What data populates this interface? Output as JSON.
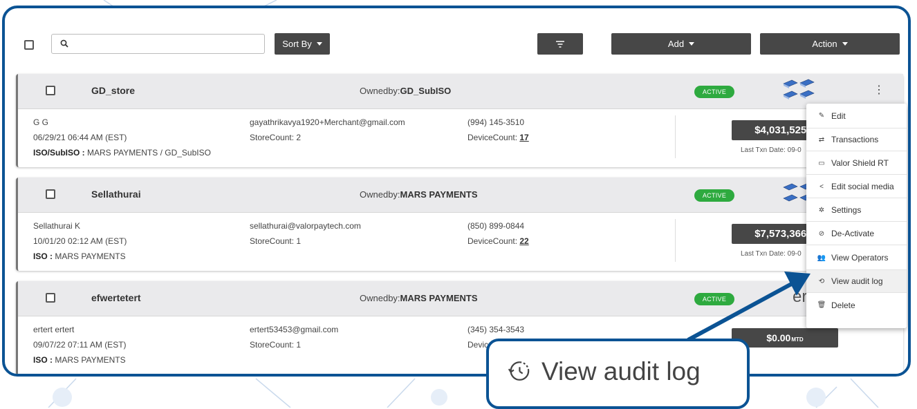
{
  "toolbar": {
    "search_placeholder": "",
    "sort_label": "Sort By",
    "add_label": "Add",
    "action_label": "Action"
  },
  "merchants": [
    {
      "name": "GD_store",
      "owned_prefix": "Ownedby:",
      "owned_by": "GD_SubISO",
      "status": "ACTIVE",
      "contact": "G G",
      "created": "06/29/21 06:44 AM (EST)",
      "iso_label": "ISO/SubISO :",
      "iso_value": " MARS PAYMENTS / GD_SubISO",
      "email": "gayathrikavya1920+Merchant@gmail.com",
      "store_count": "StoreCount: 2",
      "phone": "(994) 145-3510",
      "device_prefix": "DeviceCount: ",
      "device_count": "17",
      "amount": "$4,031,525.9",
      "txn_date": "Last Txn Date: 09-0"
    },
    {
      "name": "Sellathurai",
      "owned_prefix": "Ownedby:",
      "owned_by": "MARS PAYMENTS",
      "status": "ACTIVE",
      "contact": "Sellathurai K",
      "created": "10/01/20 02:12 AM (EST)",
      "iso_label": "ISO :",
      "iso_value": " MARS PAYMENTS",
      "email": "sellathurai@valorpaytech.com",
      "store_count": "StoreCount: 1",
      "phone": "(850) 899-0844",
      "device_prefix": "DeviceCount: ",
      "device_count": "22",
      "amount": "$7,573,366.7",
      "txn_date": "Last Txn Date: 09-0"
    },
    {
      "name": "efwertetert",
      "owned_prefix": "Ownedby:",
      "owned_by": "MARS PAYMENTS",
      "status": "ACTIVE",
      "contact": "ertert ertert",
      "created": "09/07/22 07:11 AM (EST)",
      "iso_label": "ISO :",
      "iso_value": " MARS PAYMENTS",
      "email": "ertert53453@gmail.com",
      "store_count": "StoreCount: 1",
      "phone": "(345) 354-3543",
      "device_prefix": "Device",
      "amount": "$0.00",
      "amount_suffix": "MTD",
      "logo_partial": "er"
    }
  ],
  "menu": {
    "items": [
      {
        "label": "Edit",
        "icon": "pencil-icon"
      },
      {
        "label": "Transactions",
        "icon": "transactions-icon"
      },
      {
        "label": "Valor Shield RT",
        "icon": "card-icon"
      },
      {
        "label": "Edit social media",
        "icon": "share-icon"
      },
      {
        "label": "Settings",
        "icon": "gear-icon"
      },
      {
        "label": "De-Activate",
        "icon": "block-icon"
      },
      {
        "label": "View Operators",
        "icon": "people-icon"
      },
      {
        "label": "View audit log",
        "icon": "history-icon"
      },
      {
        "label": "Delete",
        "icon": "trash-icon"
      }
    ]
  },
  "callout": {
    "label": "View audit log",
    "icon": "history-icon"
  },
  "colors": {
    "frame": "#0b5394",
    "active_badge": "#2eaa3f",
    "dark_button": "#474747"
  }
}
